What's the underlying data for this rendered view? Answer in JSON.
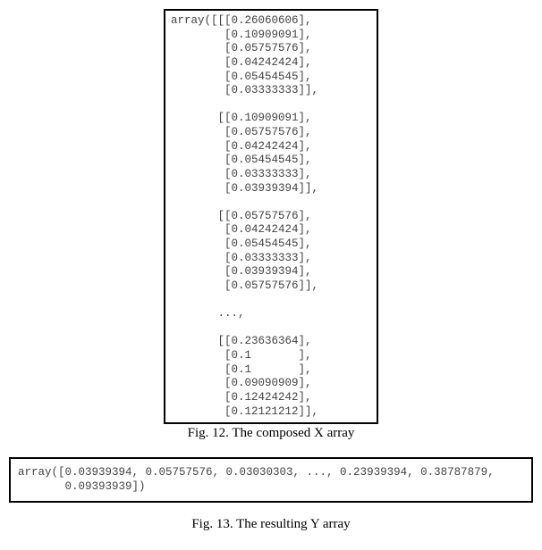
{
  "fig12": {
    "caption": "Fig. 12. The composed X array",
    "array_text": "array([[[0.26060606],\n        [0.10909091],\n        [0.05757576],\n        [0.04242424],\n        [0.05454545],\n        [0.03333333]],\n\n       [[0.10909091],\n        [0.05757576],\n        [0.04242424],\n        [0.05454545],\n        [0.03333333],\n        [0.03939394]],\n\n       [[0.05757576],\n        [0.04242424],\n        [0.05454545],\n        [0.03333333],\n        [0.03939394],\n        [0.05757576]],\n\n       ...,\n\n       [[0.23636364],\n        [0.1       ],\n        [0.1       ],\n        [0.09090909],\n        [0.12424242],\n        [0.12121212]],"
  },
  "fig13": {
    "caption": "Fig. 13. The resulting Y array",
    "array_text": "array([0.03939394, 0.05757576, 0.03030303, ..., 0.23939394, 0.38787879,\n       0.09393939])"
  },
  "chart_data": [
    {
      "type": "table",
      "title": "Fig. 12. The composed X array",
      "note": "3D numpy array preview; four visible 6x1 slices plus ellipsis",
      "slices": [
        [
          0.26060606,
          0.10909091,
          0.05757576,
          0.04242424,
          0.05454545,
          0.03333333
        ],
        [
          0.10909091,
          0.05757576,
          0.04242424,
          0.05454545,
          0.03333333,
          0.03939394
        ],
        [
          0.05757576,
          0.04242424,
          0.05454545,
          0.03333333,
          0.03939394,
          0.05757576
        ],
        "...",
        [
          0.23636364,
          0.1,
          0.1,
          0.09090909,
          0.12424242,
          0.12121212
        ]
      ]
    },
    {
      "type": "table",
      "title": "Fig. 13. The resulting Y array",
      "note": "1D numpy array preview with ellipsis",
      "values": [
        0.03939394,
        0.05757576,
        0.03030303,
        "...",
        0.23939394,
        0.38787879,
        0.09393939
      ]
    }
  ]
}
